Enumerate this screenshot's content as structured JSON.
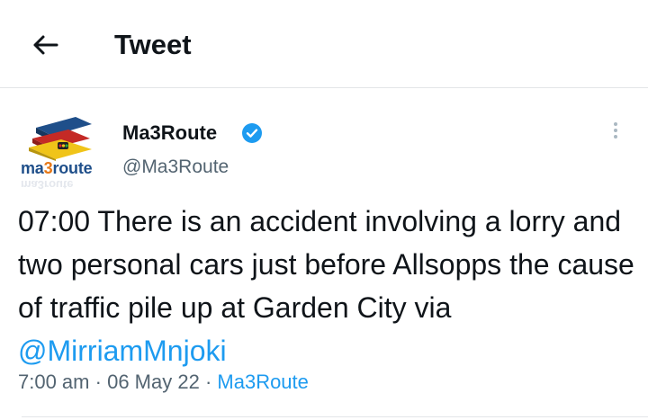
{
  "header": {
    "title": "Tweet",
    "back_icon": "arrow-left-icon"
  },
  "author": {
    "display_name": "Ma3Route",
    "handle": "@Ma3Route",
    "verified": true,
    "avatar": {
      "wordmark_prefix": "ma",
      "wordmark_three": "3",
      "wordmark_suffix": "route"
    }
  },
  "tweet": {
    "text_before": "07:00 There is an accident involving a lorry and two personal cars just before Allsopps the cause of traffic pile up at Garden City via ",
    "mention": "@MirriamMnjoki",
    "time": "7:00 am",
    "separator": "·",
    "date": "06 May 22",
    "source": "Ma3Route"
  },
  "colors": {
    "link": "#1d9bf0",
    "secondary_text": "#536471",
    "verified": "#1d9bf0"
  }
}
